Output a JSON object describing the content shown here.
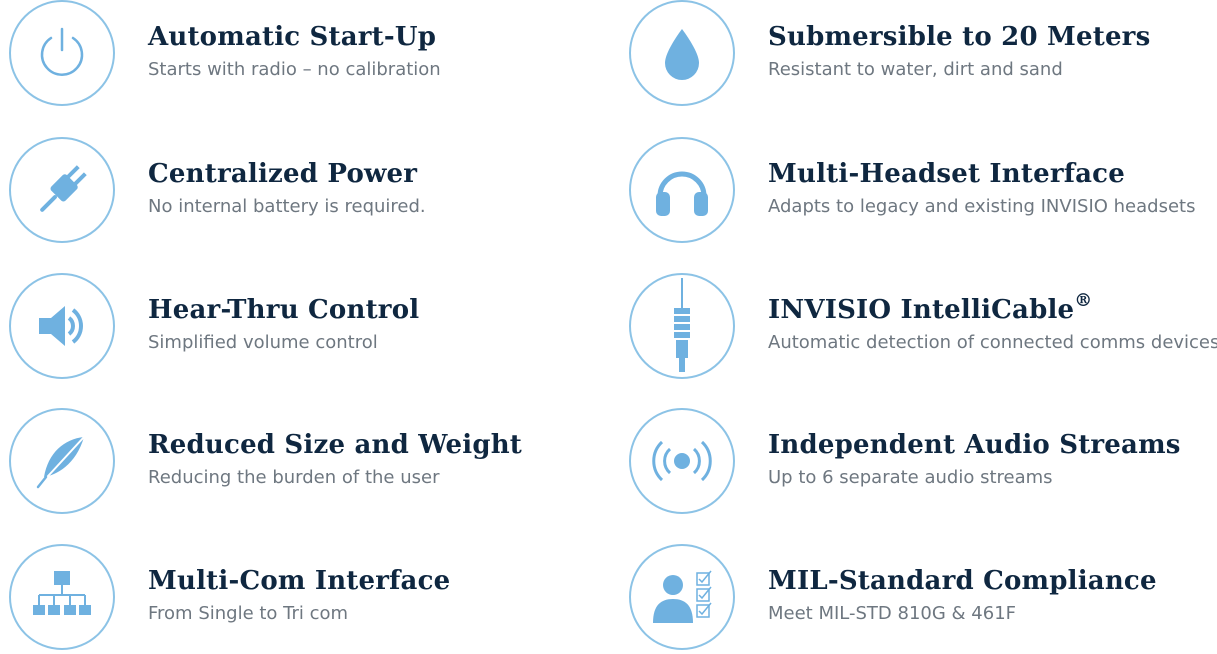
{
  "features_left": [
    {
      "title": "Automatic Start-Up",
      "desc": "Starts with radio – no calibration",
      "icon": "power-icon"
    },
    {
      "title": "Centralized Power",
      "desc": "No internal battery is required.",
      "icon": "plug-icon"
    },
    {
      "title": "Hear-Thru Control",
      "desc": "Simplified volume control",
      "icon": "speaker-icon"
    },
    {
      "title": "Reduced Size and Weight",
      "desc": "Reducing the burden of the user",
      "icon": "feather-icon"
    },
    {
      "title": "Multi-Com Interface",
      "desc": "From Single to Tri com",
      "icon": "network-icon"
    }
  ],
  "features_right": [
    {
      "title": "Submersible to 20 Meters",
      "desc": "Resistant to water, dirt and sand",
      "icon": "water-drop-icon"
    },
    {
      "title": "Multi-Headset Interface",
      "desc": "Adapts to legacy and existing INVISIO headsets",
      "icon": "headset-icon"
    },
    {
      "title": "INVISIO IntelliCable",
      "title_mark": "®",
      "desc": "Automatic detection of connected comms devices",
      "icon": "cable-icon"
    },
    {
      "title": "Independent Audio Streams",
      "desc": "Up to 6 separate audio streams",
      "icon": "broadcast-icon"
    },
    {
      "title": "MIL-Standard Compliance",
      "desc": "Meet MIL-STD 810G & 461F",
      "icon": "checklist-user-icon"
    }
  ],
  "colors": {
    "accent": "#6fb1e0",
    "circle_border": "#8cc3e6",
    "title": "#0f2740",
    "desc": "#6e7780"
  }
}
